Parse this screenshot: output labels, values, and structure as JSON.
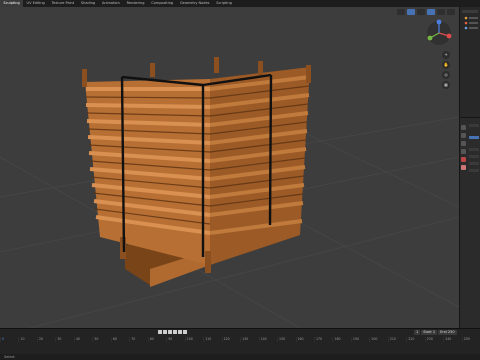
{
  "workspace_tabs": [
    "Sculpting",
    "UV Editing",
    "Texture Paint",
    "Shading",
    "Animation",
    "Rendering",
    "Compositing",
    "Geometry Nodes",
    "Scripting"
  ],
  "viewport": {
    "header_buttons": [
      "",
      "",
      "",
      ""
    ],
    "options_label": "Options"
  },
  "colors": {
    "wood_light": "#c67a3a",
    "wood_dark": "#8a4e1f",
    "strap": "#111111",
    "grid": "#4a4a4a",
    "accent": "#4772b3"
  },
  "timeline": {
    "ruler_ticks": [
      "0",
      "10",
      "20",
      "30",
      "40",
      "50",
      "60",
      "70",
      "80",
      "90",
      "100",
      "110",
      "120",
      "130",
      "140",
      "150",
      "160",
      "170",
      "180",
      "190",
      "200",
      "210",
      "220",
      "230",
      "240",
      "250"
    ],
    "frame_fields": [
      "1",
      "Start 1",
      "End 250"
    ]
  },
  "status": {
    "text": "Select"
  }
}
